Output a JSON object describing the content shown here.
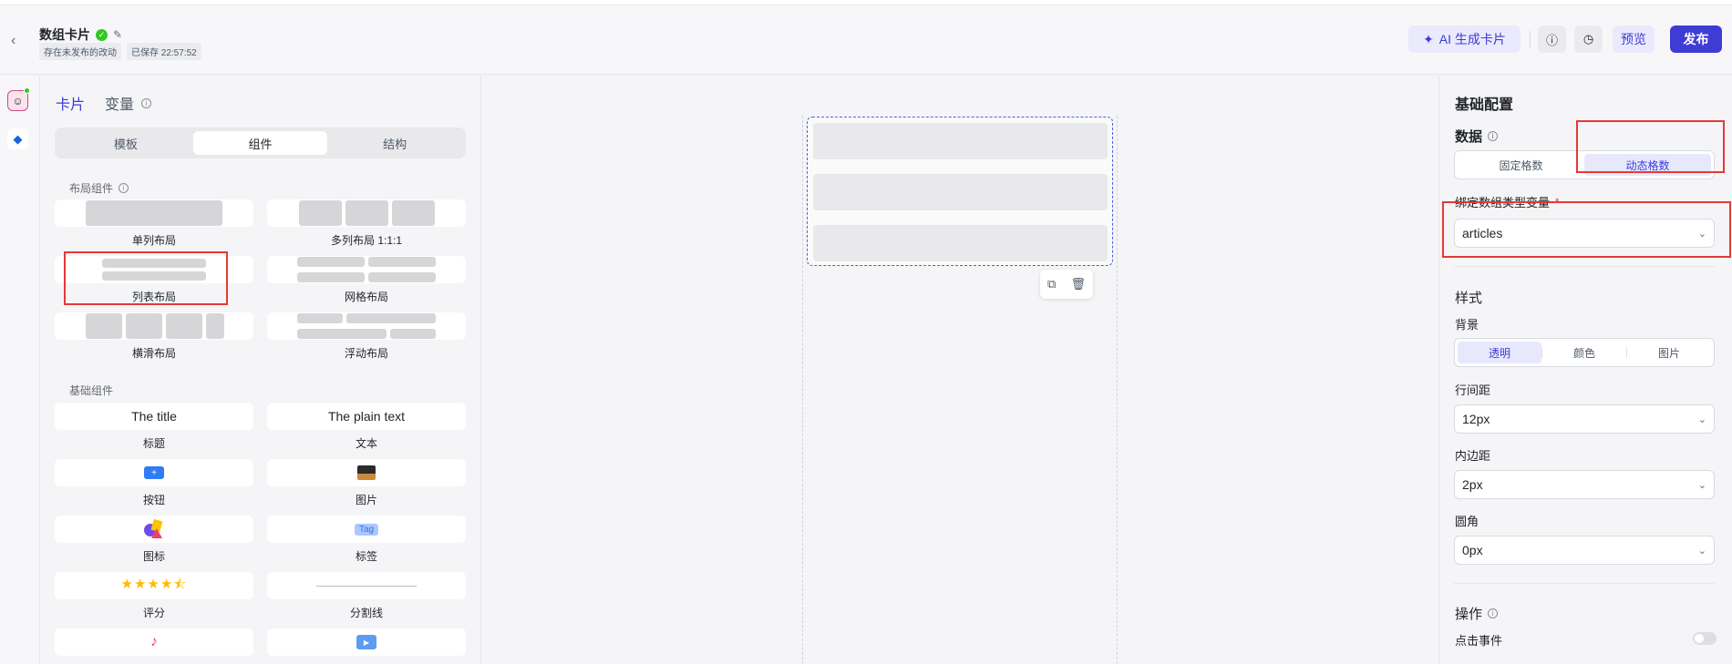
{
  "header": {
    "back_icon": "chevron-left-icon",
    "title": "数组卡片",
    "tags": [
      "存在未发布的改动",
      "已保存 22:57:52"
    ],
    "ai_button": "AI 生成卡片",
    "preview_button": "预览",
    "publish_button": "发布"
  },
  "left": {
    "tabs": [
      "卡片",
      "变量"
    ],
    "segments": [
      "模板",
      "组件",
      "结构"
    ],
    "active_segment": "组件",
    "layout_section": "布局组件",
    "layout_items": [
      "单列布局",
      "多列布局 1:1:1",
      "列表布局",
      "网格布局",
      "横滑布局",
      "浮动布局"
    ],
    "basic_section": "基础组件",
    "basic_items": [
      "标题",
      "文本",
      "按钮",
      "图片",
      "图标",
      "标签",
      "评分",
      "分割线"
    ],
    "title_preview": "The title",
    "text_preview": "The plain text",
    "tag_preview": "Tag",
    "rating_preview": "★★★★⯪"
  },
  "right": {
    "section_basic": "基础配置",
    "data_label": "数据",
    "data_options": [
      "固定格数",
      "动态格数"
    ],
    "data_active": "动态格数",
    "bind_label": "绑定数组类型变量",
    "bind_value": "articles",
    "style_section": "样式",
    "background_label": "背景",
    "background_options": [
      "透明",
      "颜色",
      "图片"
    ],
    "background_active": "透明",
    "line_spacing_label": "行间距",
    "line_spacing_value": "12px",
    "padding_label": "内边距",
    "padding_value": "2px",
    "radius_label": "圆角",
    "radius_value": "0px",
    "action_section": "操作",
    "click_event_label": "点击事件"
  },
  "colors": {
    "accent": "#3d3bd8",
    "publish_bg": "#3f3cd6",
    "highlight": "#e53935",
    "success": "#34c724"
  }
}
